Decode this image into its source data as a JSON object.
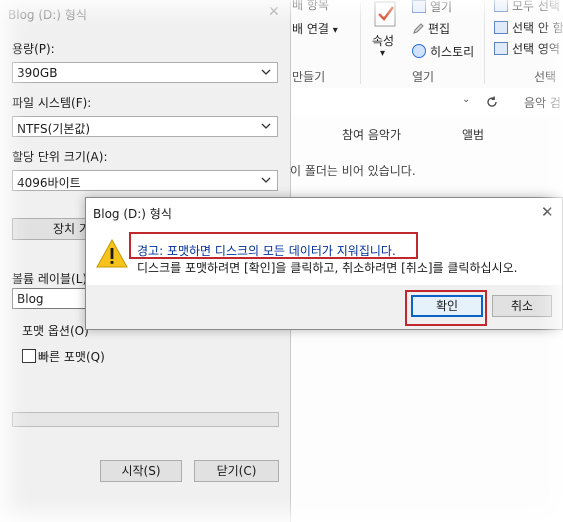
{
  "explorer": {
    "ribbon": {
      "share_item": "배 항목",
      "open_with": "배 연결",
      "open_with_arrow": "▾",
      "properties": "속성",
      "open": "열기",
      "edit": "편집",
      "history": "히스토리",
      "select_all": "모두 선택",
      "select_none": "선택 안 함",
      "invert_selection": "선택 영역",
      "group_new": "만들기",
      "group_open": "열기",
      "group_select": "선택"
    },
    "address": {
      "location": "음악 검"
    },
    "columns": [
      "참여 음악가",
      "앨범"
    ],
    "empty_message": "이 폴더는 비어 있습니다."
  },
  "format_panel": {
    "title": "Blog (D:) 형식",
    "close_glyph": "✕",
    "capacity_label": "용량(P):",
    "capacity_value": "390GB",
    "filesystem_label": "파일 시스템(F):",
    "filesystem_value": "NTFS(기본값)",
    "alloc_label": "할당 단위 크기(A):",
    "alloc_value": "4096바이트",
    "restore_button": "장치 기본",
    "volume_label": "볼륨 레이블(L)",
    "volume_value": "Blog",
    "format_options": "포맷 옵션(O)",
    "quick_format": "빠른 포맷(Q)",
    "progress": 0,
    "start_button": "시작(S)",
    "close_button": "닫기(C)"
  },
  "warning_dialog": {
    "title": "Blog (D:) 형식",
    "close_glyph": "✕",
    "warning_text": "경고: 포맷하면 디스크의 모든 데이터가 지워집니다.",
    "instruction_text": "디스크를 포맷하려면 [확인]을 클릭하고, 취소하려면 [취소]를 클릭하십시오.",
    "ok_button": "확인",
    "cancel_button": "취소"
  },
  "colors": {
    "highlight_box": "#c1272d",
    "primary_button_border": "#0a64c8",
    "warning_text": "#002f9a",
    "warning_icon": "#f7c21b"
  },
  "icons": [
    "properties-check-icon",
    "open-icon",
    "edit-pen-icon",
    "history-icon",
    "select-all-icon",
    "select-none-icon",
    "invert-selection-icon",
    "refresh-icon",
    "chevron-down-icon",
    "close-icon",
    "warning-icon",
    "checkbox"
  ]
}
